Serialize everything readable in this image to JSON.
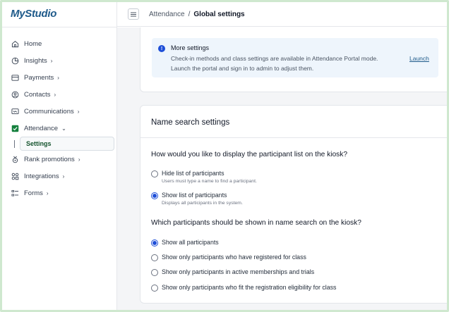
{
  "app": {
    "logo": "MyStudio"
  },
  "sidebar": {
    "items": [
      {
        "label": "Home",
        "icon": "home-icon",
        "chevron": ""
      },
      {
        "label": "Insights",
        "icon": "chart-pie-icon",
        "chevron": "›"
      },
      {
        "label": "Payments",
        "icon": "credit-card-icon",
        "chevron": "›"
      },
      {
        "label": "Contacts",
        "icon": "user-circle-icon",
        "chevron": "›"
      },
      {
        "label": "Communications",
        "icon": "chat-icon",
        "chevron": "›"
      },
      {
        "label": "Attendance",
        "icon": "checkbox-icon",
        "chevron": "⌄"
      },
      {
        "label": "Rank promotions",
        "icon": "medal-icon",
        "chevron": "›"
      },
      {
        "label": "Integrations",
        "icon": "integrations-icon",
        "chevron": "›"
      },
      {
        "label": "Forms",
        "icon": "forms-icon",
        "chevron": "›"
      }
    ],
    "sub_item": "Settings"
  },
  "header": {
    "crumb_parent": "Attendance",
    "crumb_sep": "/",
    "crumb_current": "Global settings"
  },
  "banner": {
    "title": "More settings",
    "text_line1": "Check-in methods and class settings are available in Attendance Portal mode.",
    "text_line2": "Launch the portal and sign in to admin to adjust them.",
    "link": "Launch"
  },
  "name_search": {
    "title": "Name search settings",
    "q1": "How would you like to display the participant list on the kiosk?",
    "q1_options": [
      {
        "label": "Hide list of participants",
        "sub": "Users must type a name to find a participant.",
        "selected": false
      },
      {
        "label": "Show list of participants",
        "sub": "Displays all participants in the system.",
        "selected": true
      }
    ],
    "q2": "Which participants should be shown in name search on the kiosk?",
    "q2_options": [
      {
        "label": "Show all participants",
        "selected": true
      },
      {
        "label": "Show only participants who have registered for class",
        "selected": false
      },
      {
        "label": "Show only participants in active memberships and trials",
        "selected": false
      },
      {
        "label": "Show only participants who fit the registration eligibility for class",
        "selected": false
      }
    ]
  },
  "colors": {
    "accent": "#1d4ed8",
    "brand": "#1e5a8a",
    "attendance_check": "#15803d"
  }
}
